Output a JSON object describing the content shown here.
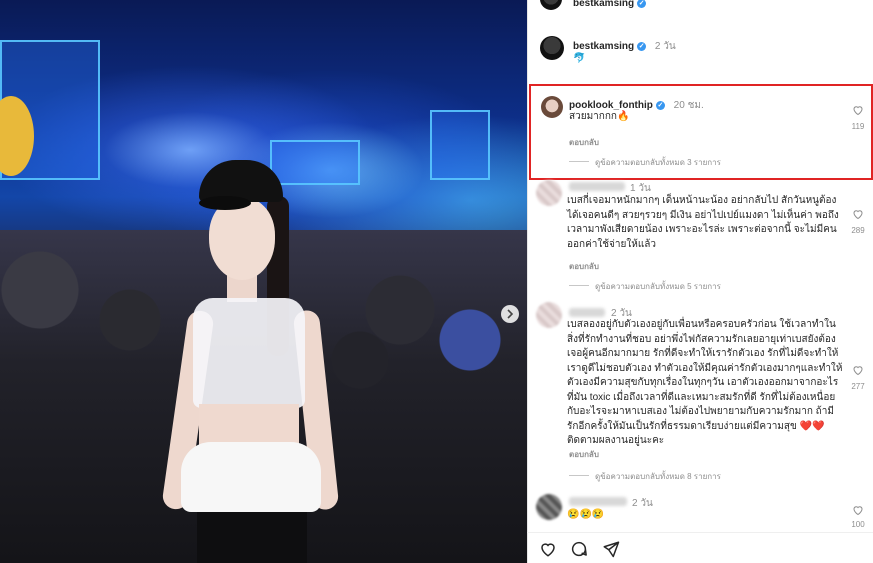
{
  "post": {
    "author": "bestkamsing",
    "caption_author": "bestkamsing",
    "caption_time": "2 วัน",
    "caption_emoji": "🐬"
  },
  "comments": [
    {
      "username": "pooklook_fonthip",
      "time": "20 ชม.",
      "text": "สวยมากกก🔥",
      "likes": "119",
      "reply_label": "ตอบกลับ",
      "view_replies": "ดูข้อความตอบกลับทั้งหมด 3 รายการ",
      "highlighted": true
    },
    {
      "username": "",
      "time": "1 วัน",
      "text": "เบสกี่เจอมาหนักมากๆ เด็นหน้านะน้อง อย่ากลับไป สักวันหนูต้องได้เจอคนดีๆ สวยๆรวยๆ มีเงิน อย่าไปเปย์แมงดา ไม่เห็นค่า พอถึงเวลามาพังเสียดายน้อง เพราะอะไรล่ะ เพราะต่อจากนี้ จะไม่มีคนออกค่าใช้จ่ายให้แล้ว",
      "likes": "289",
      "reply_label": "ตอบกลับ",
      "view_replies": "ดูข้อความตอบกลับทั้งหมด 5 รายการ",
      "highlighted": false
    },
    {
      "username": "",
      "time": "2 วัน",
      "text": "เบสลองอยู่กับตัวเองอยู่กับเพื่อนหรือครอบครัวก่อน ใช้เวลาทำในสิ่งที่รักทำงานที่ชอบ อย่าพึ่งไฟกัสความรักเลยอายุเท่าเบสยังต้องเจอผู้คนอีกมากมาย รักที่ดีจะทำให้เรารักตัวเอง รักที่ไม่ดีจะทำให้เราดูดีไม่ชอบตัวเอง ทำตัวเองให้มีคุณค่ารักตัวเองมากๆและทำให้ตัวเองมีความสุขกับทุกเรื่องในทุกๆวัน เอาตัวเองออกมาจากอะไรที่มัน toxic เมื่อถึงเวลาที่ดีและเหมาะสมรักที่ดี รักที่ไม่ต้องเหนื่อยกับอะไรจะมาหาเบสเอง ไม่ต้องไปพยายามกับความรักมาก ถ้ามีรักอีกครั้งให้มันเป็นรักที่ธรรมดาเรียบง่ายแต่มีความสุข ❤️❤️ติดตามผลงานอยู่นะคะ",
      "likes": "277",
      "reply_label": "ตอบกลับ",
      "view_replies": "ดูข้อความตอบกลับทั้งหมด 8 รายการ",
      "highlighted": false
    },
    {
      "username": "",
      "time": "2 วัน",
      "text": "😢😢😢",
      "likes": "100",
      "highlighted": false
    }
  ],
  "actions": {
    "like_icon": "heart-outline-icon",
    "comment_icon": "speech-bubble-icon",
    "share_icon": "paper-plane-icon"
  },
  "colors": {
    "highlight_border": "#e02424",
    "verified": "#3897f0",
    "muted_text": "#8e8e8e"
  }
}
